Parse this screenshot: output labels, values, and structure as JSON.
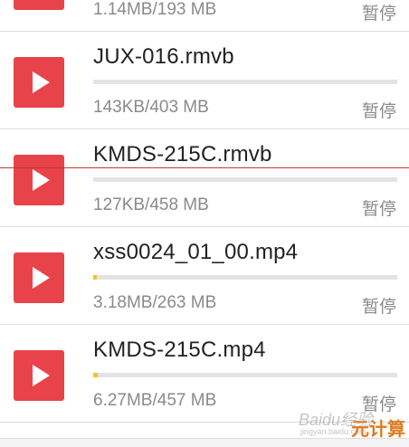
{
  "downloads": [
    {
      "filename": "",
      "size_text": "1.14MB/193 MB",
      "action_label": "暂停",
      "progress": 0.006,
      "icon": "play-icon"
    },
    {
      "filename": "JUX-016.rmvb",
      "size_text": "143KB/403 MB",
      "action_label": "暂停",
      "progress": 0.0,
      "icon": "play-icon"
    },
    {
      "filename": "KMDS-215C.rmvb",
      "size_text": "127KB/458 MB",
      "action_label": "暂停",
      "progress": 0.0,
      "icon": "play-icon"
    },
    {
      "filename": "xss0024_01_00.mp4",
      "size_text": "3.18MB/263 MB",
      "action_label": "暂停",
      "progress": 0.012,
      "icon": "play-icon"
    },
    {
      "filename": "KMDS-215C.mp4",
      "size_text": "6.27MB/457 MB",
      "action_label": "暂停",
      "progress": 0.014,
      "icon": "play-icon"
    }
  ],
  "watermark": {
    "logo_text": "Baidu经验",
    "sub_text": "jingyan.baidu.com",
    "badge_text": "元计算"
  },
  "colors": {
    "accent": "#e8434a",
    "progress_fill": "#f2c12e",
    "track": "#e3e3e3",
    "secondary_text": "#8a8a8a"
  }
}
